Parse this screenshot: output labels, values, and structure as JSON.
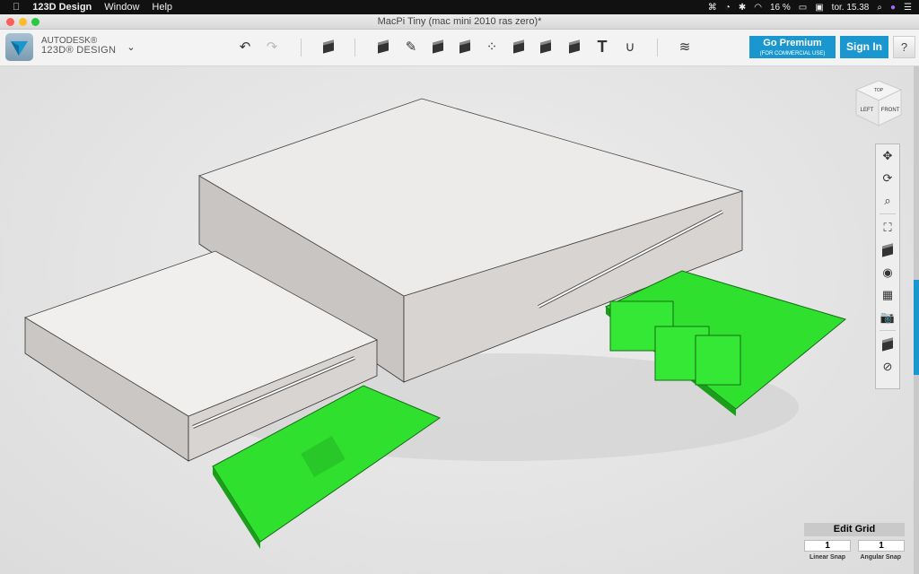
{
  "menubar": {
    "app": "123D Design",
    "items": [
      "Window",
      "Help"
    ],
    "battery": "16 %",
    "clock": "tor. 15.38"
  },
  "window": {
    "title": "MacPi Tiny (mac mini 2010 ras zero)*"
  },
  "brand": {
    "line1": "AUTODESK®",
    "line2": "123D® DESIGN"
  },
  "toolbar": {
    "text_tool": "T",
    "premium_label": "Go Premium",
    "premium_sub": "(FOR COMMERCIAL USE)",
    "signin_label": "Sign In",
    "help_label": "?"
  },
  "viewcube": {
    "top": "TOP",
    "left": "LEFT",
    "front": "FRONT"
  },
  "grid": {
    "title": "Edit Grid",
    "linear_value": "1",
    "angular_value": "1",
    "linear_label": "Linear Snap",
    "angular_label": "Angular Snap"
  },
  "colors": {
    "accent": "#1a97cf",
    "board": "#2fe02f"
  }
}
